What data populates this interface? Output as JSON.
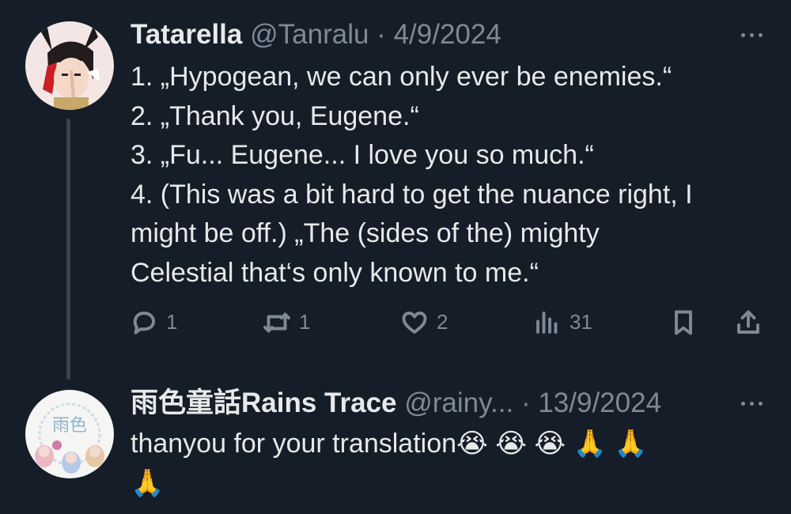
{
  "tweet1": {
    "display_name": "Tatarella",
    "handle": "@Tanralu",
    "separator": "·",
    "date": "4/9/2024",
    "lines": [
      "1. „Hypogean, we can only ever be enemies.“",
      "2. „Thank you, Eugene.“",
      "3. „Fu... Eugene... I love you so much.“",
      "4. (This was a bit hard to get the nuance right, I",
      "might be off.) „The (sides of the) mighty",
      "Celestial that‘s only known to me.“"
    ],
    "actions": {
      "reply_count": "1",
      "retweet_count": "1",
      "like_count": "2",
      "views_count": "31"
    }
  },
  "tweet2": {
    "display_name": "雨色童話Rains Trace",
    "handle": "@rainy...",
    "separator": "·",
    "date": "13/9/2024",
    "text": "thanyou for your translation",
    "emoji_line1": "😭 😭 😭 🙏 🙏",
    "emoji_line2": "🙏"
  },
  "icons": [
    "reply-icon",
    "retweet-icon",
    "like-icon",
    "views-icon",
    "bookmark-icon",
    "share-icon",
    "more-icon"
  ],
  "colors": {
    "background": "#151d28",
    "text": "#e7e9ea",
    "muted": "#7d8a96"
  }
}
